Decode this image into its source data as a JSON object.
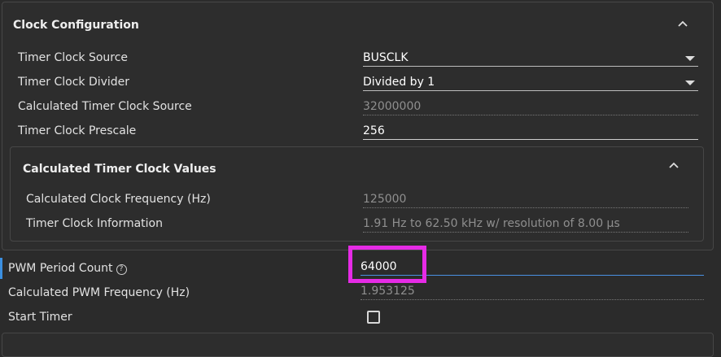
{
  "clock_config": {
    "title": "Clock Configuration",
    "rows": [
      {
        "label": "Timer Clock Source",
        "value": "BUSCLK"
      },
      {
        "label": "Timer Clock Divider",
        "value": "Divided by 1"
      },
      {
        "label": "Calculated Timer Clock Source",
        "value": "32000000"
      },
      {
        "label": "Timer Clock Prescale",
        "value": "256"
      }
    ]
  },
  "calc_values": {
    "title": "Calculated Timer Clock Values",
    "rows": [
      {
        "label": "Calculated Clock Frequency (Hz)",
        "value": "125000"
      },
      {
        "label": "Timer Clock Information",
        "value": "1.91 Hz to 62.50 kHz w/ resolution of 8.00 µs"
      }
    ]
  },
  "pwm": {
    "period_label": "PWM Period Count",
    "period_help_glyph": "?",
    "period_value": "64000",
    "freq_label": "Calculated PWM Frequency (Hz)",
    "freq_value": "1.953125",
    "start_label": "Start Timer",
    "start_checked": false
  },
  "colors": {
    "accent": "#3b8fe0",
    "highlight": "#e62be6",
    "background": "#2b2b2b"
  }
}
